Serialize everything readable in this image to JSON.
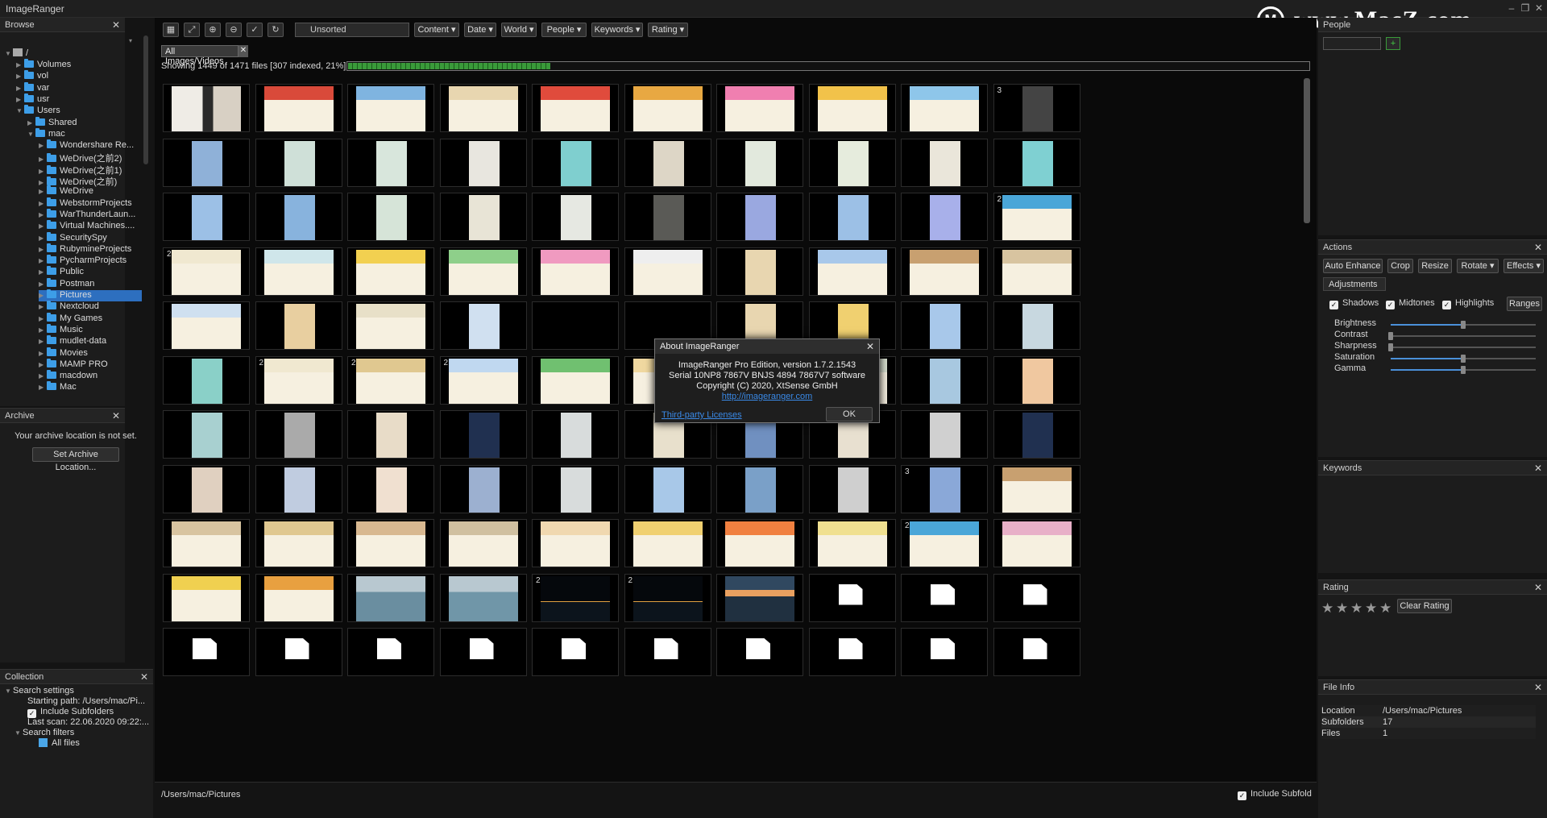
{
  "app": {
    "title": "ImageRanger"
  },
  "watermark": {
    "text": "www.MacZ.com",
    "logo": "M"
  },
  "browse": {
    "title": "Browse",
    "root": "/",
    "items": [
      {
        "label": "Volumes",
        "depth": 1,
        "expanded": false,
        "selected": false
      },
      {
        "label": "vol",
        "depth": 1,
        "expanded": false,
        "selected": false
      },
      {
        "label": "var",
        "depth": 1,
        "expanded": false,
        "selected": false
      },
      {
        "label": "usr",
        "depth": 1,
        "expanded": false,
        "selected": false
      },
      {
        "label": "Users",
        "depth": 1,
        "expanded": true,
        "selected": false
      },
      {
        "label": "Shared",
        "depth": 2,
        "expanded": false,
        "selected": false
      },
      {
        "label": "mac",
        "depth": 2,
        "expanded": true,
        "selected": false
      },
      {
        "label": "Wondershare Re...",
        "depth": 3,
        "expanded": false,
        "selected": false
      },
      {
        "label": "WeDrive(之前2)",
        "depth": 3,
        "expanded": false,
        "selected": false
      },
      {
        "label": "WeDrive(之前1)",
        "depth": 3,
        "expanded": false,
        "selected": false
      },
      {
        "label": "WeDrive(之前)",
        "depth": 3,
        "expanded": false,
        "selected": false
      },
      {
        "label": "WeDrive",
        "depth": 3,
        "expanded": false,
        "selected": false
      },
      {
        "label": "WebstormProjects",
        "depth": 3,
        "expanded": false,
        "selected": false
      },
      {
        "label": "WarThunderLaun...",
        "depth": 3,
        "expanded": false,
        "selected": false
      },
      {
        "label": "Virtual Machines....",
        "depth": 3,
        "expanded": false,
        "selected": false
      },
      {
        "label": "SecuritySpy",
        "depth": 3,
        "expanded": false,
        "selected": false
      },
      {
        "label": "RubymineProjects",
        "depth": 3,
        "expanded": false,
        "selected": false
      },
      {
        "label": "PycharmProjects",
        "depth": 3,
        "expanded": false,
        "selected": false
      },
      {
        "label": "Public",
        "depth": 3,
        "expanded": false,
        "selected": false
      },
      {
        "label": "Postman",
        "depth": 3,
        "expanded": false,
        "selected": false
      },
      {
        "label": "Pictures",
        "depth": 3,
        "expanded": false,
        "selected": true
      },
      {
        "label": "Nextcloud",
        "depth": 3,
        "expanded": false,
        "selected": false
      },
      {
        "label": "My Games",
        "depth": 3,
        "expanded": false,
        "selected": false
      },
      {
        "label": "Music",
        "depth": 3,
        "expanded": false,
        "selected": false
      },
      {
        "label": "mudlet-data",
        "depth": 3,
        "expanded": false,
        "selected": false
      },
      {
        "label": "Movies",
        "depth": 3,
        "expanded": false,
        "selected": false
      },
      {
        "label": "MAMP PRO",
        "depth": 3,
        "expanded": false,
        "selected": false
      },
      {
        "label": "macdown",
        "depth": 3,
        "expanded": false,
        "selected": false
      },
      {
        "label": "Mac",
        "depth": 3,
        "expanded": false,
        "selected": false
      }
    ]
  },
  "archive": {
    "title": "Archive",
    "message": "Your archive location is not set.",
    "button": "Set Archive Location..."
  },
  "collection": {
    "title": "Collection",
    "search_settings": "Search settings",
    "starting_path": "Starting path: /Users/mac/Pi...",
    "include_subfolders": "Include Subfolders",
    "last_scan": "Last scan: 22.06.2020 09:22:...",
    "search_filters": "Search filters",
    "all_files": "All files"
  },
  "toolbar": {
    "sort": "Unsorted",
    "filters": [
      "Content",
      "Date",
      "World",
      "People",
      "Keywords",
      "Rating"
    ]
  },
  "tab": {
    "label": "All Images/Videos"
  },
  "status": {
    "text": "Showing 1449 of 1471 files [307 indexed, 21%]",
    "progress": 0.21
  },
  "footer": {
    "path": "/Users/mac/Pictures",
    "include_subfolders": "Include Subfold"
  },
  "thumbs": {
    "rows": [
      [
        {
          "k": "photo",
          "c": "#d9d2c8"
        },
        {
          "k": "poster",
          "c": "#d94a3a"
        },
        {
          "k": "poster",
          "c": "#7fb4e0"
        },
        {
          "k": "poster",
          "c": "#e8d6b0"
        },
        {
          "k": "poster",
          "c": "#e04b3c"
        },
        {
          "k": "poster",
          "c": "#e8a842"
        },
        {
          "k": "poster",
          "c": "#f07fb0"
        },
        {
          "k": "poster",
          "c": "#f2c24a"
        },
        {
          "k": "poster",
          "c": "#8ec6ea"
        },
        {
          "k": "portrait",
          "c": "#444",
          "badge": "3"
        }
      ],
      [
        {
          "k": "portrait",
          "c": "#8fb1d8"
        },
        {
          "k": "portrait",
          "c": "#cfe0d8"
        },
        {
          "k": "portrait",
          "c": "#d8e6dc"
        },
        {
          "k": "portrait",
          "c": "#e8e6df"
        },
        {
          "k": "portrait",
          "c": "#7fcfcf"
        },
        {
          "k": "portrait",
          "c": "#ddd6c6"
        },
        {
          "k": "portrait",
          "c": "#e2e9dd"
        },
        {
          "k": "portrait",
          "c": "#e6ecdd"
        },
        {
          "k": "portrait",
          "c": "#eae6da"
        },
        {
          "k": "portrait",
          "c": "#7fd0d2"
        }
      ],
      [
        {
          "k": "portrait",
          "c": "#9cc0e6"
        },
        {
          "k": "portrait",
          "c": "#88b3dd"
        },
        {
          "k": "portrait",
          "c": "#d6e4d8"
        },
        {
          "k": "portrait",
          "c": "#e8e4d6"
        },
        {
          "k": "portrait",
          "c": "#e6e8e2"
        },
        {
          "k": "portrait",
          "c": "#5a5a56"
        },
        {
          "k": "portrait",
          "c": "#9aa8e0"
        },
        {
          "k": "portrait",
          "c": "#9cc0e6"
        },
        {
          "k": "portrait",
          "c": "#a8b0ea"
        },
        {
          "k": "poster",
          "c": "#4aa6d8",
          "badge": "2"
        }
      ],
      [
        {
          "k": "poster",
          "c": "#f0e8d0",
          "badge": "2"
        },
        {
          "k": "poster",
          "c": "#cfe6ea"
        },
        {
          "k": "poster",
          "c": "#f2d050"
        },
        {
          "k": "poster",
          "c": "#8ecf8a"
        },
        {
          "k": "poster",
          "c": "#f09ac0"
        },
        {
          "k": "poster",
          "c": "#eeeeee"
        },
        {
          "k": "portrait",
          "c": "#e8d6b0"
        },
        {
          "k": "poster",
          "c": "#a8c8ea"
        },
        {
          "k": "poster",
          "c": "#c8a070"
        },
        {
          "k": "poster",
          "c": "#d8c4a0"
        }
      ],
      [
        {
          "k": "poster",
          "c": "#cfe0f0"
        },
        {
          "k": "portrait",
          "c": "#e8cfa0"
        },
        {
          "k": "poster",
          "c": "#e8e0c8"
        },
        {
          "k": "portrait",
          "c": "#d0e0f0"
        },
        {
          "k": "empty"
        },
        {
          "k": "empty"
        },
        {
          "k": "portrait",
          "c": "#e8d6b0"
        },
        {
          "k": "portrait",
          "c": "#f0d070"
        },
        {
          "k": "portrait",
          "c": "#a8c8ea"
        },
        {
          "k": "portrait",
          "c": "#c8d8e0"
        }
      ],
      [
        {
          "k": "portrait",
          "c": "#8ad0c8"
        },
        {
          "k": "poster",
          "c": "#f0e8d0",
          "badge": "2"
        },
        {
          "k": "poster",
          "c": "#e0c890",
          "badge": "2"
        },
        {
          "k": "poster",
          "c": "#c0d8f0",
          "badge": "2"
        },
        {
          "k": "poster",
          "c": "#70c070"
        },
        {
          "k": "poster",
          "c": "#f0d8a0"
        },
        {
          "k": "poster",
          "c": "#e8c090"
        },
        {
          "k": "poster",
          "c": "#d8e0d0"
        },
        {
          "k": "portrait",
          "c": "#a8c8e0"
        },
        {
          "k": "portrait",
          "c": "#f0c8a0"
        }
      ],
      [
        {
          "k": "portrait",
          "c": "#a8d0d0"
        },
        {
          "k": "portrait",
          "c": "#aaaaaa"
        },
        {
          "k": "portrait",
          "c": "#e8dcc8"
        },
        {
          "k": "portrait",
          "c": "#203050"
        },
        {
          "k": "portrait",
          "c": "#d8dcdc"
        },
        {
          "k": "portrait",
          "c": "#e8e0cc"
        },
        {
          "k": "portrait",
          "c": "#7090c0"
        },
        {
          "k": "portrait",
          "c": "#e8e0d0"
        },
        {
          "k": "portrait",
          "c": "#d0d0d0"
        },
        {
          "k": "portrait",
          "c": "#203050"
        }
      ],
      [
        {
          "k": "portrait",
          "c": "#e0d0c0"
        },
        {
          "k": "portrait",
          "c": "#c0cce0"
        },
        {
          "k": "portrait",
          "c": "#f0e0d0"
        },
        {
          "k": "portrait",
          "c": "#9cb0d0"
        },
        {
          "k": "portrait",
          "c": "#d8dcdc"
        },
        {
          "k": "portrait",
          "c": "#a8c8e8"
        },
        {
          "k": "portrait",
          "c": "#7aa0c8"
        },
        {
          "k": "portrait",
          "c": "#cfcfcf"
        },
        {
          "k": "portrait",
          "c": "#8aa8d8",
          "badge": "3"
        },
        {
          "k": "poster",
          "c": "#c8a070"
        }
      ],
      [
        {
          "k": "poster",
          "c": "#d8c4a0"
        },
        {
          "k": "poster",
          "c": "#e0c890"
        },
        {
          "k": "poster",
          "c": "#d8b890"
        },
        {
          "k": "poster",
          "c": "#d0c0a0"
        },
        {
          "k": "poster",
          "c": "#f0d8b0"
        },
        {
          "k": "poster",
          "c": "#f0d070"
        },
        {
          "k": "poster",
          "c": "#f08040"
        },
        {
          "k": "poster",
          "c": "#f0e090"
        },
        {
          "k": "poster",
          "c": "#4aa6d8",
          "badge": "2"
        },
        {
          "k": "poster",
          "c": "#e8b0c8"
        }
      ],
      [
        {
          "k": "poster",
          "c": "#f0d050"
        },
        {
          "k": "poster",
          "c": "#e8a040"
        },
        {
          "k": "sea",
          "c": "#6a8ea0"
        },
        {
          "k": "sea",
          "c": "#7096a8"
        },
        {
          "k": "night",
          "c": "#101820",
          "badge": "2"
        },
        {
          "k": "night",
          "c": "#101820",
          "badge": "2"
        },
        {
          "k": "sunset",
          "c": "#e8a060"
        },
        {
          "k": "doc"
        },
        {
          "k": "doc"
        },
        {
          "k": "doc"
        }
      ],
      [
        {
          "k": "doc"
        },
        {
          "k": "doc"
        },
        {
          "k": "doc"
        },
        {
          "k": "doc"
        },
        {
          "k": "doc"
        },
        {
          "k": "doc"
        },
        {
          "k": "doc"
        },
        {
          "k": "doc"
        },
        {
          "k": "doc"
        },
        {
          "k": "doc"
        }
      ]
    ]
  },
  "about": {
    "title": "About ImageRanger",
    "line1": "ImageRanger Pro Edition, version 1.7.2.1543",
    "line2": "Serial 10NP8 7867V BNJS 4894 7867V7 software",
    "line3": "Copyright (C) 2020, XtSense GmbH",
    "link": "http://imageranger.com",
    "third_party": "Third-party Licenses",
    "ok": "OK"
  },
  "right": {
    "top_title": "People",
    "actions": {
      "title": "Actions",
      "buttons": [
        "Auto Enhance",
        "Crop",
        "Resize",
        "Rotate",
        "Effects"
      ]
    },
    "adjustments": {
      "tab": "Adjustments",
      "shadows": "Shadows",
      "midtones": "Midtones",
      "highlights": "Highlights",
      "ranges": "Ranges",
      "sliders": [
        {
          "label": "Brightness",
          "value": 0.5
        },
        {
          "label": "Contrast",
          "value": 0.0
        },
        {
          "label": "Sharpness",
          "value": 0.0
        },
        {
          "label": "Saturation",
          "value": 0.5
        },
        {
          "label": "Gamma",
          "value": 0.5
        }
      ]
    },
    "keywords": {
      "title": "Keywords"
    },
    "rating": {
      "title": "Rating",
      "stars": 5,
      "clear": "Clear Rating"
    },
    "fileinfo": {
      "title": "File Info",
      "rows": [
        {
          "k": "Location",
          "v": "/Users/mac/Pictures"
        },
        {
          "k": "Subfolders",
          "v": "17"
        },
        {
          "k": "Files",
          "v": "1"
        }
      ]
    }
  }
}
